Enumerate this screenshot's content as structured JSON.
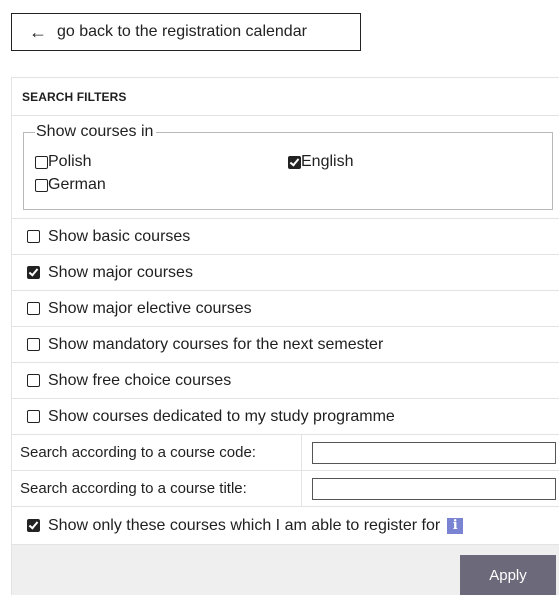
{
  "back_button": {
    "arrow": "←",
    "label": "go back to the registration calendar"
  },
  "filters": {
    "header": "SEARCH FILTERS",
    "languages": {
      "legend": "Show courses in",
      "options": [
        {
          "label": "Polish",
          "checked": false
        },
        {
          "label": "English",
          "checked": true
        },
        {
          "label": "German",
          "checked": false
        }
      ]
    },
    "options": [
      {
        "label": "Show basic courses",
        "checked": false
      },
      {
        "label": "Show major courses",
        "checked": true
      },
      {
        "label": "Show major elective courses",
        "checked": false
      },
      {
        "label": "Show mandatory courses for the next semester",
        "checked": false
      },
      {
        "label": "Show free choice courses",
        "checked": false
      },
      {
        "label": "Show courses dedicated to my study programme",
        "checked": false
      }
    ],
    "search_code": {
      "label": "Search according to a course code:",
      "value": ""
    },
    "search_title": {
      "label": "Search according to a course title:",
      "value": ""
    },
    "register_only": {
      "label": "Show only these courses which I am able to register for",
      "checked": true,
      "info_icon": "i"
    },
    "apply_label": "Apply"
  },
  "colors": {
    "apply_bg": "#6c6a7a",
    "info_icon": "#7b84d3",
    "footer_bg": "#efefef"
  }
}
